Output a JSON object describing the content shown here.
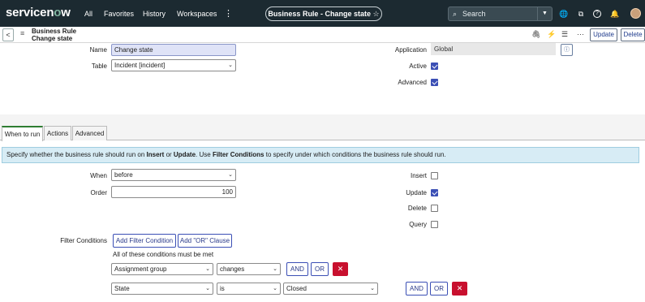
{
  "topnav": {
    "logo_a": "servicen",
    "logo_o": "o",
    "logo_b": "w",
    "links": [
      "All",
      "Favorites",
      "History",
      "Workspaces"
    ],
    "kebab": "⋮",
    "title_pill": "Business Rule - Change state",
    "star": "☆",
    "search_placeholder": "Search",
    "search_icon": "⌕",
    "dd": "▼",
    "icons": [
      "🌐",
      "⧉",
      "?",
      "🔔"
    ]
  },
  "header": {
    "back": "<",
    "menu": "≡",
    "record_type": "Business Rule",
    "record_name": "Change state",
    "icons": [
      "🖇",
      "⚡",
      "☰",
      "···"
    ],
    "update_label": "Update",
    "delete_label": "Delete"
  },
  "form": {
    "name_label": "Name",
    "name_value": "Change state",
    "table_label": "Table",
    "table_value": "Incident [incident]",
    "application_label": "Application",
    "application_value": "Global",
    "info_icon": "ⓘ",
    "active_label": "Active",
    "active_checked": true,
    "advanced_label": "Advanced",
    "advanced_checked": true
  },
  "tabs": [
    {
      "label": "When to run",
      "active": true
    },
    {
      "label": "Actions",
      "active": false
    },
    {
      "label": "Advanced",
      "active": false
    }
  ],
  "info_text": {
    "p1": "Specify whether the business rule should run on ",
    "b1": "Insert",
    "p2": " or ",
    "b2": "Update",
    "p3": ". Use ",
    "b3": "Filter Conditions",
    "p4": " to specify under which conditions the business rule should run."
  },
  "when_to_run": {
    "when_label": "When",
    "when_value": "before",
    "order_label": "Order",
    "order_value": "100",
    "insert_label": "Insert",
    "insert_checked": false,
    "update_label": "Update",
    "update_checked": true,
    "delete_label": "Delete",
    "delete_checked": false,
    "query_label": "Query",
    "query_checked": false,
    "filter_label": "Filter Conditions",
    "add_filter_label": "Add Filter Condition",
    "add_or_label": "Add \"OR\" Clause",
    "all_met_text": "All of these conditions must be met",
    "conditions": [
      {
        "field": "Assignment group",
        "operator": "changes",
        "value": "",
        "and": "AND",
        "or": "OR",
        "remove": "✕"
      },
      {
        "field": "State",
        "operator": "is",
        "value": "Closed",
        "and": "AND",
        "or": "OR",
        "remove": "✕"
      }
    ]
  },
  "colors": {
    "nav_bg": "#1c2a31",
    "accent": "#3b4fb5",
    "remove": "#c8102e",
    "info_bg": "#d7ecf5",
    "active_tab": "#2e7d32"
  }
}
